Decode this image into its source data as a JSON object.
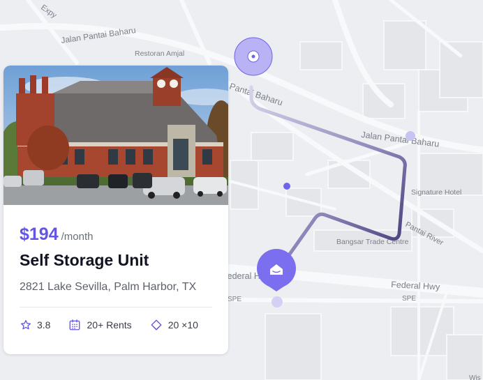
{
  "map": {
    "labels": {
      "jalan_pantai_baharu_top": "Jalan Pantai Baharu",
      "restoran_amjal": "Restoran Amjal",
      "pantai_baharu": "Pantai Baharu",
      "jalan_pantai_baharu_right": "Jalan Pantai Baharu",
      "signature_hotel": "Signature Hotel",
      "pantai_river": "Pantai River",
      "bangsar_trade_centre": "Bangsar Trade Centre",
      "federal_hwy": "Federal Hwy",
      "federal_hwy_left": "Federal Hwy",
      "spe_left": "SPE",
      "spe_right": "SPE",
      "expy": "Expy",
      "wis": "Wis"
    },
    "route_color": "#4a3f8a",
    "accent": "#7b6ff0"
  },
  "listing": {
    "price": "$194",
    "period": "/month",
    "title": "Self Storage Unit",
    "address": "2821 Lake Sevilla, Palm Harbor, TX",
    "rating": "3.8",
    "rents": "20+  Rents",
    "size": "20 ×10",
    "icons": [
      "star-icon",
      "calendar-icon",
      "layers-icon"
    ]
  }
}
